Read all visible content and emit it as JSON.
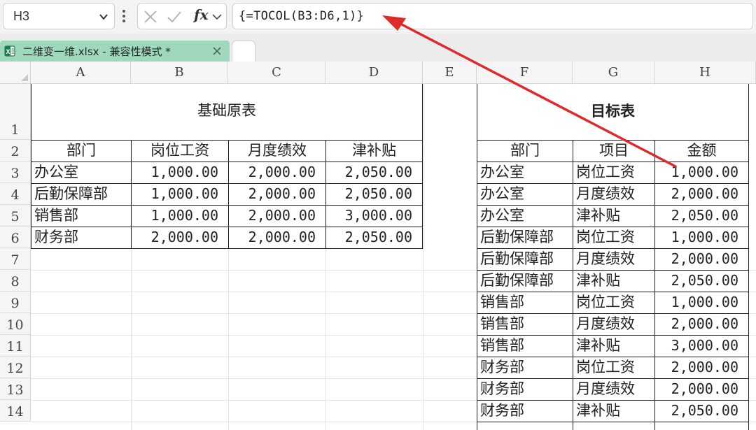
{
  "formula_bar": {
    "name_box": "H3",
    "fx_label": "fx",
    "formula": "{=TOCOL(B3:D6,1)}"
  },
  "tabs": {
    "file_tab_label": "二维变一维.xlsx  -  兼容性模式 *"
  },
  "columns": [
    "A",
    "B",
    "C",
    "D",
    "E",
    "F",
    "G",
    "H"
  ],
  "rows": [
    "1",
    "2",
    "3",
    "4",
    "5",
    "6",
    "7",
    "8",
    "9",
    "10",
    "11",
    "12",
    "13",
    "14"
  ],
  "source_table": {
    "title": "基础原表",
    "headers": [
      "部门",
      "岗位工资",
      "月度绩效",
      "津补贴"
    ],
    "rows": [
      [
        "办公室",
        "1,000.00",
        "2,000.00",
        "2,050.00"
      ],
      [
        "后勤保障部",
        "1,000.00",
        "2,000.00",
        "2,050.00"
      ],
      [
        "销售部",
        "1,000.00",
        "2,000.00",
        "3,000.00"
      ],
      [
        "财务部",
        "2,000.00",
        "2,000.00",
        "2,050.00"
      ]
    ]
  },
  "target_table": {
    "title": "目标表",
    "headers": [
      "部门",
      "项目",
      "金额"
    ],
    "rows": [
      [
        "办公室",
        "岗位工资",
        "1,000.00"
      ],
      [
        "办公室",
        "月度绩效",
        "2,000.00"
      ],
      [
        "办公室",
        "津补贴",
        "2,050.00"
      ],
      [
        "后勤保障部",
        "岗位工资",
        "1,000.00"
      ],
      [
        "后勤保障部",
        "月度绩效",
        "2,000.00"
      ],
      [
        "后勤保障部",
        "津补贴",
        "2,050.00"
      ],
      [
        "销售部",
        "岗位工资",
        "1,000.00"
      ],
      [
        "销售部",
        "月度绩效",
        "2,000.00"
      ],
      [
        "销售部",
        "津补贴",
        "3,000.00"
      ],
      [
        "财务部",
        "岗位工资",
        "2,000.00"
      ],
      [
        "财务部",
        "月度绩效",
        "2,000.00"
      ],
      [
        "财务部",
        "津补贴",
        "2,050.00"
      ]
    ]
  },
  "annotation": {
    "arrow_color": "#e02a2a",
    "arrow_note": "red arrow pointing from cell H3 to the formula"
  }
}
